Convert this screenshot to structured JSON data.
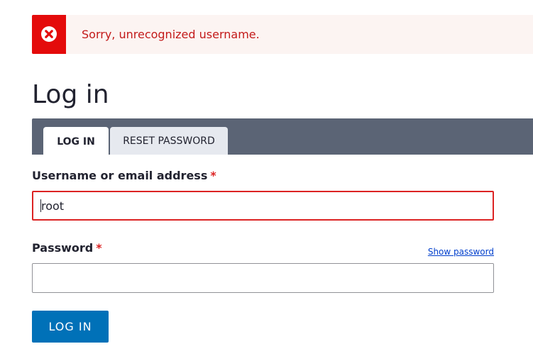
{
  "message": {
    "type": "error",
    "icon": "error-x-icon",
    "text": "Sorry, unrecognized username."
  },
  "page": {
    "title": "Log in"
  },
  "tabs": [
    {
      "label": "Log in",
      "active": true
    },
    {
      "label": "Reset password",
      "active": false
    }
  ],
  "form": {
    "username": {
      "label": "Username or email address",
      "required_marker": "*",
      "value": "root"
    },
    "password": {
      "label": "Password",
      "required_marker": "*",
      "value": "",
      "show_password_label": "Show password"
    },
    "submit_label": "Log in"
  },
  "colors": {
    "error_red": "#e40b0b",
    "error_bg": "#fcf4f2",
    "tab_bar": "#5b6475",
    "primary_button": "#0071b8",
    "link": "#003ecc"
  }
}
